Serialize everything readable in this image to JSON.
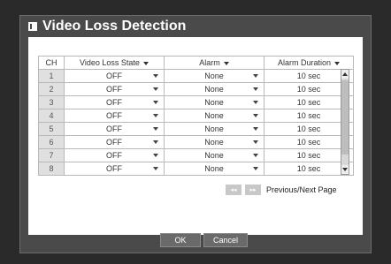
{
  "dialog": {
    "title": "Video Loss Detection",
    "headers": {
      "ch": "CH",
      "state": "Video Loss State",
      "alarm": "Alarm",
      "duration": "Alarm Duration"
    },
    "rows": [
      {
        "ch": "1",
        "state": "OFF",
        "alarm": "None",
        "duration": "10 sec"
      },
      {
        "ch": "2",
        "state": "OFF",
        "alarm": "None",
        "duration": "10 sec"
      },
      {
        "ch": "3",
        "state": "OFF",
        "alarm": "None",
        "duration": "10 sec"
      },
      {
        "ch": "4",
        "state": "OFF",
        "alarm": "None",
        "duration": "10 sec"
      },
      {
        "ch": "5",
        "state": "OFF",
        "alarm": "None",
        "duration": "10 sec"
      },
      {
        "ch": "6",
        "state": "OFF",
        "alarm": "None",
        "duration": "10 sec"
      },
      {
        "ch": "7",
        "state": "OFF",
        "alarm": "None",
        "duration": "10 sec"
      },
      {
        "ch": "8",
        "state": "OFF",
        "alarm": "None",
        "duration": "10 sec"
      }
    ],
    "pager": {
      "prev": "◂◂",
      "next": "▸▸",
      "label": "Previous/Next Page"
    },
    "ok_label": "OK",
    "cancel_label": "Cancel"
  }
}
